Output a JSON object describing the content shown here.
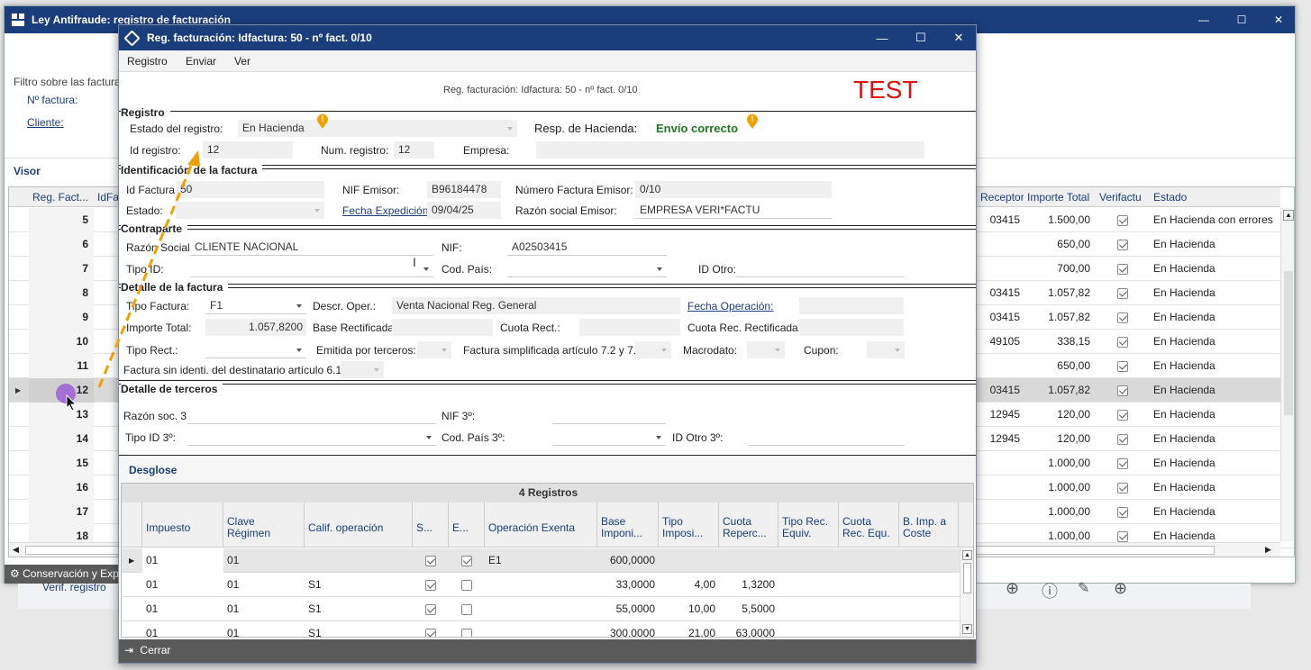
{
  "back_window": {
    "title": "Ley Antifraude: registro de facturación",
    "filter_label": "Filtro sobre las facturas",
    "nfactura_label": "Nº factura:",
    "cliente_label": "Cliente:",
    "visor_label": "Visor",
    "columns": [
      "Reg. Fact...",
      "IdFac",
      "Receptor",
      "Importe Total",
      "Verifactu",
      "Estado"
    ],
    "rows": [
      {
        "reg": "5",
        "receptor": "03415",
        "importe": "1.500,00",
        "verifactu": true,
        "estado": "En Hacienda con errores"
      },
      {
        "reg": "6",
        "receptor": "",
        "importe": "650,00",
        "verifactu": true,
        "estado": "En Hacienda"
      },
      {
        "reg": "7",
        "receptor": "",
        "importe": "700,00",
        "verifactu": true,
        "estado": "En Hacienda"
      },
      {
        "reg": "8",
        "receptor": "03415",
        "importe": "1.057,82",
        "verifactu": true,
        "estado": "En Hacienda"
      },
      {
        "reg": "9",
        "receptor": "03415",
        "importe": "1.057,82",
        "verifactu": true,
        "estado": "En Hacienda"
      },
      {
        "reg": "10",
        "receptor": "49105",
        "importe": "338,15",
        "verifactu": true,
        "estado": "En Hacienda"
      },
      {
        "reg": "11",
        "receptor": "",
        "importe": "650,00",
        "verifactu": true,
        "estado": "En Hacienda"
      },
      {
        "reg": "12",
        "receptor": "03415",
        "importe": "1.057,82",
        "verifactu": true,
        "estado": "En Hacienda"
      },
      {
        "reg": "13",
        "receptor": "12945",
        "importe": "120,00",
        "verifactu": true,
        "estado": "En Hacienda"
      },
      {
        "reg": "14",
        "receptor": "12945",
        "importe": "120,00",
        "verifactu": true,
        "estado": "En Hacienda"
      },
      {
        "reg": "15",
        "receptor": "",
        "importe": "1.000,00",
        "verifactu": true,
        "estado": "En Hacienda"
      },
      {
        "reg": "16",
        "receptor": "",
        "importe": "1.000,00",
        "verifactu": true,
        "estado": "En Hacienda"
      },
      {
        "reg": "17",
        "receptor": "",
        "importe": "1.000,00",
        "verifactu": true,
        "estado": "En Hacienda"
      },
      {
        "reg": "18",
        "receptor": "",
        "importe": "1.000,00",
        "verifactu": true,
        "estado": "En Hacienda"
      }
    ],
    "footer_label": "Conservación y Exp",
    "verif_label": "Verif. registro"
  },
  "dialog": {
    "title": "Reg. facturación: Idfactura: 50 - nº fact. 0/10",
    "menu": [
      "Registro",
      "Enviar",
      "Ver"
    ],
    "subtitle": "Reg. facturación: Idfactura: 50 - nº fact. 0/10",
    "test_label": "TEST",
    "registro": {
      "section": "Registro",
      "estado_label": "Estado del registro:",
      "estado_value": "En Hacienda",
      "resp_label": "Resp. de Hacienda:",
      "resp_value": "Envío correcto",
      "id_label": "Id registro:",
      "id_value": "12",
      "num_label": "Num. registro:",
      "num_value": "12",
      "empresa_label": "Empresa:",
      "empresa_value": ""
    },
    "identificacion": {
      "section": "Identificación de la factura",
      "idfactura_label": "Id Factura",
      "idfactura_value": "50",
      "nif_label": "NIF Emisor:",
      "nif_value": "B96184478",
      "numfact_label": "Número Factura Emisor:",
      "numfact_value": "0/10",
      "estado_label": "Estado:",
      "fecha_label": "Fecha Expedición",
      "fecha_value": "09/04/25",
      "razon_label": "Razón social Emisor:",
      "razon_value": "EMPRESA VERI*FACTU"
    },
    "contraparte": {
      "section": "Contraparte",
      "razon_label": "Razón Social:",
      "razon_value": "CLIENTE NACIONAL",
      "nif_label": "NIF:",
      "nif_value": "A02503415",
      "tipoid_label": "Tipo ID:",
      "codpais_label": "Cod. País:",
      "idotro_label": "ID Otro:"
    },
    "detalle": {
      "section": "Detalle de la factura",
      "tipo_label": "Tipo Factura:",
      "tipo_value": "F1",
      "descr_label": "Descr. Oper.:",
      "descr_value": "Venta Nacional Reg. General",
      "fechaop_label": "Fecha Operación:",
      "importe_label": "Importe Total:",
      "importe_value": "1.057,8200",
      "base_rect_label": "Base Rectificada",
      "cuota_rect_label": "Cuota Rect.:",
      "cuota_rec_label": "Cuota Rec. Rectificada:",
      "tiporect_label": "Tipo Rect.:",
      "emitida_label": "Emitida por terceros:",
      "simplificada_label": "Factura simplificada artículo 7.2 y 7.",
      "macrodato_label": "Macrodato:",
      "cupon_label": "Cupon:",
      "sin_ident_label": "Factura sin identi. del destinatario artículo 6.1"
    },
    "terceros": {
      "section": "Detalle de terceros",
      "razon_label": "Razón soc. 3",
      "nif_label": "NIF 3º:",
      "tipoid_label": "Tipo ID 3º:",
      "codpais_label": "Cod. País 3º:",
      "idotro_label": "ID Otro 3º:"
    },
    "desglose": {
      "section": "Desglose",
      "count_label": "4 Registros",
      "columns": [
        "Impuesto",
        "Clave Régimen",
        "Calif. operación",
        "S...",
        "E...",
        "Operación Exenta",
        "Base Imponi...",
        "Tipo Imposi...",
        "Cuota Reperc...",
        "Tipo Rec. Equiv.",
        "Cuota Rec. Equ.",
        "B. Imp. a Coste"
      ],
      "rows": [
        {
          "impuesto": "01",
          "clave": "01",
          "calif": "",
          "s": true,
          "e": true,
          "exenta": "E1",
          "base": "600,0000",
          "tipo": "",
          "cuota": ""
        },
        {
          "impuesto": "01",
          "clave": "01",
          "calif": "S1",
          "s": true,
          "e": false,
          "exenta": "",
          "base": "33,0000",
          "tipo": "4,00",
          "cuota": "1,3200"
        },
        {
          "impuesto": "01",
          "clave": "01",
          "calif": "S1",
          "s": true,
          "e": false,
          "exenta": "",
          "base": "55,0000",
          "tipo": "10,00",
          "cuota": "5,5000"
        },
        {
          "impuesto": "01",
          "clave": "01",
          "calif": "S1",
          "s": true,
          "e": false,
          "exenta": "",
          "base": "300,0000",
          "tipo": "21,00",
          "cuota": "63,0000"
        }
      ]
    },
    "close_label": "Cerrar"
  },
  "colors": {
    "titlebar": "#1a3d7c",
    "ok_green": "#1e7a1e",
    "test_red": "#e31010",
    "warn": "#f0a000"
  }
}
